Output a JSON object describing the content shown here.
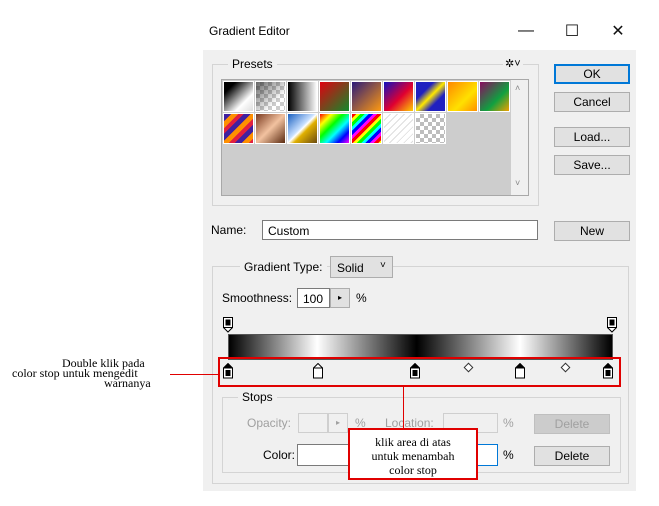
{
  "window": {
    "title": "Gradient Editor",
    "minimize_glyph": "—",
    "maximize_glyph": "☐",
    "close_glyph": "✕"
  },
  "presets": {
    "label": "Presets",
    "gear_glyph": "✲˅"
  },
  "buttons": {
    "ok": "OK",
    "cancel": "Cancel",
    "load": "Load...",
    "save": "Save...",
    "new": "New",
    "delete": "Delete"
  },
  "name": {
    "label": "Name:",
    "value": "Custom"
  },
  "gradient_type": {
    "label": "Gradient Type:",
    "value": "Solid"
  },
  "smoothness": {
    "label": "Smoothness:",
    "value": "100",
    "unit": "%"
  },
  "stops": {
    "label": "Stops",
    "opacity_label": "Opacity:",
    "location_label": "Location:",
    "color_label": "Color:",
    "percent": "%"
  },
  "annotations": {
    "left_line1": "Double klik pada",
    "left_line2": "color stop untuk mengedit",
    "left_line3": "warnanya",
    "box_line1": "klik area di atas",
    "box_line2": "untuk menambah",
    "box_line3": "color stop"
  },
  "colors": {
    "accent": "#0078d7",
    "annotation": "#e00000"
  }
}
